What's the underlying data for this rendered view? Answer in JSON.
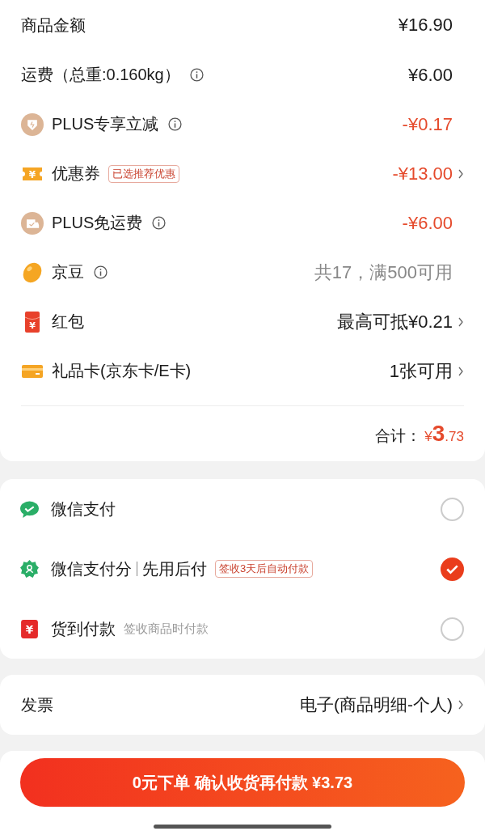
{
  "summary": {
    "rows": [
      {
        "kind": "plain",
        "label": "商品金额",
        "value": "¥16.90",
        "color": "#1a1a1a",
        "info": false,
        "chevron": false
      },
      {
        "kind": "plain",
        "label": "运费（总重:0.160kg）",
        "value": "¥6.00",
        "color": "#1a1a1a",
        "info": true,
        "chevron": false
      },
      {
        "kind": "plus-discount",
        "label": "PLUS专享立减",
        "value": "-¥0.17",
        "color": "#e54a2c",
        "info": true,
        "chevron": false
      },
      {
        "kind": "coupon",
        "badge_text": "¥",
        "label": "优惠券",
        "tag": "已选推荐优惠",
        "value": "-¥13.00",
        "color": "#e54a2c",
        "info": false,
        "chevron": true
      },
      {
        "kind": "plus-shipping",
        "label": "PLUS免运费",
        "value": "-¥6.00",
        "color": "#e54a2c",
        "info": true,
        "chevron": false
      },
      {
        "kind": "bean",
        "label": "京豆",
        "value": "共17，满500可用",
        "color": "#888888",
        "info": true,
        "chevron": false
      },
      {
        "kind": "red-packet",
        "badge_text": "¥",
        "label": "红包",
        "value": "最高可抵¥0.21",
        "color": "#1a1a1a",
        "info": false,
        "chevron": true
      },
      {
        "kind": "gift-card",
        "label": "礼品卡(京东卡/E卡)",
        "value": "1张可用",
        "color": "#1a1a1a",
        "info": false,
        "chevron": true
      }
    ],
    "total": {
      "label": "合计：",
      "currency": "¥",
      "integer": "3",
      "decimal": ".73"
    }
  },
  "payment_methods": [
    {
      "kind": "wechat",
      "label": "微信支付",
      "selected": false
    },
    {
      "kind": "wechat-score",
      "label": "微信支付分",
      "suffix": "先用后付",
      "tag": "签收3天后自动付款",
      "selected": true
    },
    {
      "kind": "cod",
      "badge_text": "¥",
      "label": "货到付款",
      "note": "签收商品时付款",
      "selected": false
    }
  ],
  "invoice": {
    "label": "发票",
    "value": "电子(商品明细-个人)"
  },
  "submit_button": "0元下单 确认收货再付款 ¥3.73"
}
